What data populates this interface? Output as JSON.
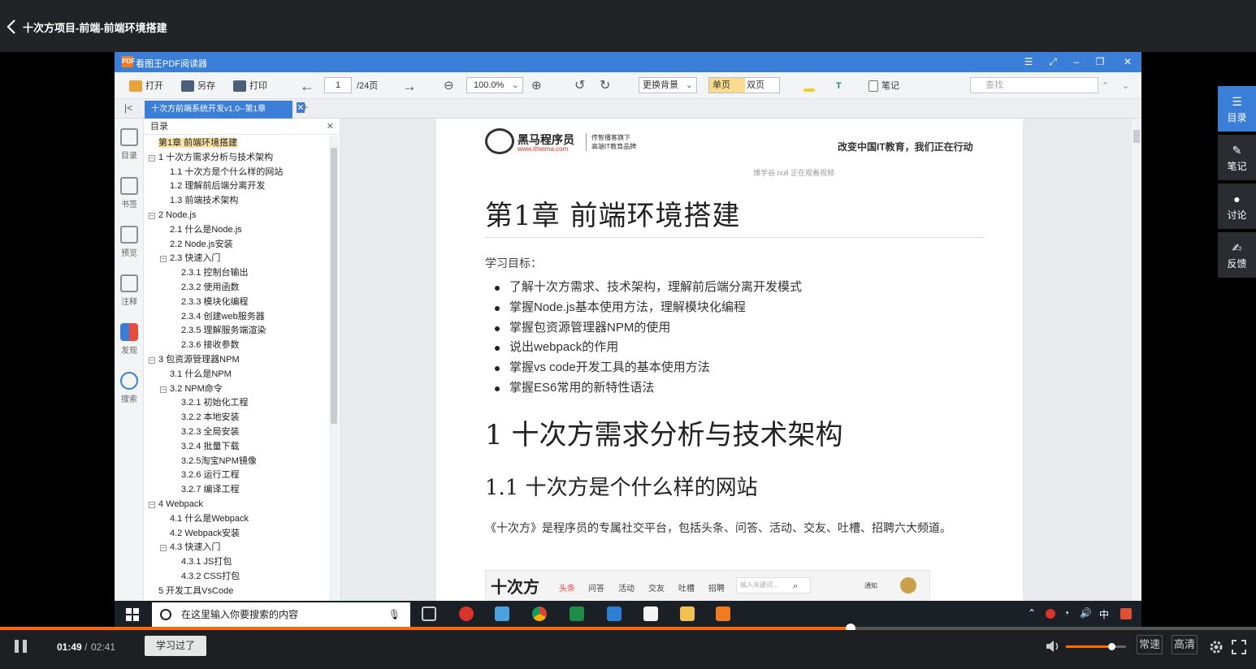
{
  "header": {
    "title": "十次方项目-前端-前端环境搭建"
  },
  "app": {
    "title": "看图王PDF阅读器",
    "logo_text": "PDF",
    "toolbar": {
      "open": "打开",
      "saveas": "另存",
      "print": "打印",
      "page_current": "1",
      "page_total": "/24页",
      "zoom": "100.0%",
      "background": "更换背景",
      "single": "单页",
      "double": "双页",
      "note": "笔记",
      "search_placeholder": "查找"
    },
    "tab": {
      "label": "十次方前端系统开发v1.0--第1章"
    },
    "left_icons": [
      {
        "label": "目录"
      },
      {
        "label": "书签"
      },
      {
        "label": "预览"
      },
      {
        "label": "注释"
      },
      {
        "label": "发现"
      },
      {
        "label": "搜索"
      }
    ],
    "toc": {
      "title": "目录",
      "items": [
        {
          "text": "第1章 前端环境搭建",
          "level": 0
        },
        {
          "text": "1 十次方需求分析与技术架构",
          "level": 0
        },
        {
          "text": "1.1 十次方是个什么样的网站",
          "level": 1
        },
        {
          "text": "1.2 理解前后端分离开发",
          "level": 1
        },
        {
          "text": "1.3 前端技术架构",
          "level": 1
        },
        {
          "text": "2 Node.js",
          "level": 0
        },
        {
          "text": "2.1 什么是Node.js",
          "level": 1
        },
        {
          "text": "2.2 Node.js安装",
          "level": 1
        },
        {
          "text": "2.3 快速入门",
          "level": 1
        },
        {
          "text": "2.3.1 控制台输出",
          "level": 2
        },
        {
          "text": "2.3.2 使用函数",
          "level": 2
        },
        {
          "text": "2.3.3 模块化编程",
          "level": 2
        },
        {
          "text": "2.3.4 创建web服务器",
          "level": 2
        },
        {
          "text": "2.3.5 理解服务端渲染",
          "level": 2
        },
        {
          "text": "2.3.6 接收参数",
          "level": 2
        },
        {
          "text": "3 包资源管理器NPM",
          "level": 0
        },
        {
          "text": "3.1 什么是NPM",
          "level": 1
        },
        {
          "text": "3.2 NPM命令",
          "level": 1
        },
        {
          "text": "3.2.1 初始化工程",
          "level": 2
        },
        {
          "text": "3.2.2 本地安装",
          "level": 2
        },
        {
          "text": "3.2.3 全局安装",
          "level": 2
        },
        {
          "text": "3.2.4 批量下载",
          "level": 2
        },
        {
          "text": "3.2.5淘宝NPM镜像",
          "level": 2
        },
        {
          "text": "3.2.6 运行工程",
          "level": 2
        },
        {
          "text": "3.2.7 编译工程",
          "level": 2
        },
        {
          "text": "4 Webpack",
          "level": 0
        },
        {
          "text": "4.1 什么是Webpack",
          "level": 1
        },
        {
          "text": "4.2 Webpack安装",
          "level": 1
        },
        {
          "text": "4.3 快速入门",
          "level": 1
        },
        {
          "text": "4.3.1 JS打包",
          "level": 2
        },
        {
          "text": "4.3.2 CSS打包",
          "level": 2
        },
        {
          "text": "5 开发工具VsCode",
          "level": 0
        }
      ]
    },
    "doc": {
      "brand_name": "黑马程序员",
      "brand_url": "www.itheima.com",
      "brand_tag1": "传智播客旗下",
      "brand_tag2": "高端IT教育品牌",
      "slogan": "改变中国IT教育，我们正在行动",
      "watermark": "博学谷 null 正在观看视频",
      "h1": "第1章 前端环境搭建",
      "goal_title": "学习目标：",
      "goals": [
        "了解十次方需求、技术架构，理解前后端分离开发模式",
        "掌握Node.js基本使用方法，理解模块化编程",
        "掌握包资源管理器NPM的使用",
        "说出webpack的作用",
        "掌握vs code开发工具的基本使用方法",
        "掌握ES6常用的新特性语法"
      ],
      "h2": "1 十次方需求分析与技术架构",
      "h3": "1.1 十次方是个什么样的网站",
      "para": "《十次方》是程序员的专属社交平台，包括头条、问答、活动、交友、吐槽、招聘六大频道。",
      "shot": {
        "logo": "十次方",
        "nav": [
          "头条",
          "问答",
          "活动",
          "交友",
          "吐槽",
          "招聘"
        ],
        "search_placeholder": "输入关键词...",
        "notice": "通知"
      }
    }
  },
  "taskbar": {
    "search_placeholder": "在这里输入你要搜索的内容",
    "ime": "中"
  },
  "player": {
    "current_time": "01:49",
    "separator": "/",
    "total_time": "02:41",
    "progress": 0.677,
    "learned_label": "学习过了",
    "volume": 0.76,
    "speed_label": "常速",
    "quality_label": "高清"
  },
  "side_panel": [
    {
      "label": "目录"
    },
    {
      "label": "笔记"
    },
    {
      "label": "讨论"
    },
    {
      "label": "反馈"
    }
  ],
  "colors": {
    "accent": "#ff6a00",
    "app_blue": "#3b7ed8",
    "panel_active": "#3b7ed8"
  }
}
